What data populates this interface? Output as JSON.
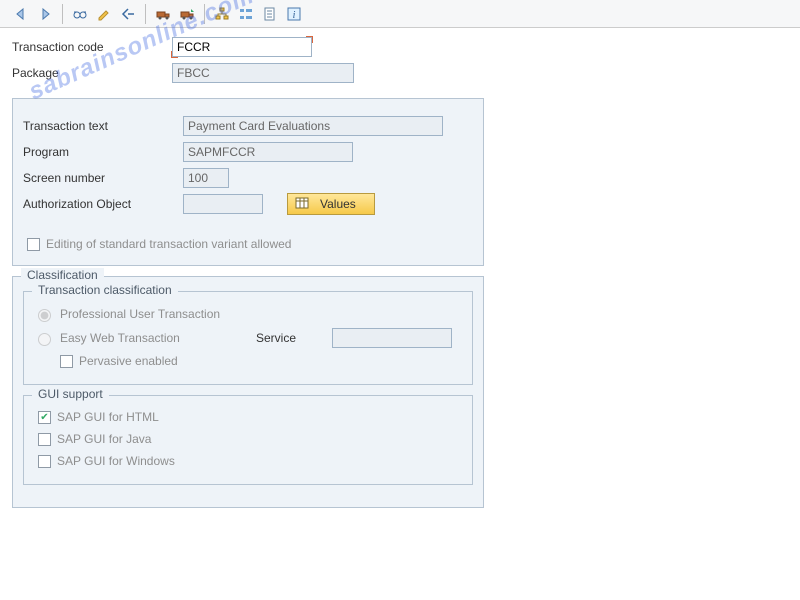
{
  "toolbar": {
    "back": "Back",
    "forward": "Forward",
    "glasses": "Display",
    "pencil": "Change",
    "copy": "Other object",
    "transport1": "Transport",
    "transport2": "Transport entry",
    "hierarchy": "Where-used",
    "align": "Object directory",
    "docu": "Documentation",
    "info": "Information"
  },
  "header": {
    "tcode_label": "Transaction code",
    "tcode_value": "FCCR",
    "package_label": "Package",
    "package_value": "FBCC"
  },
  "detail": {
    "text_label": "Transaction text",
    "text_value": "Payment Card Evaluations",
    "program_label": "Program",
    "program_value": "SAPMFCCR",
    "screen_label": "Screen number",
    "screen_value": "100",
    "auth_label": "Authorization Object",
    "auth_value": "",
    "values_label": "Values",
    "variant_checkbox": "Editing of standard transaction variant allowed"
  },
  "classification": {
    "title": "Classification",
    "tc_title": "Transaction classification",
    "opt_prof": "Professional User Transaction",
    "opt_easy": "Easy Web Transaction",
    "service_label": "Service",
    "service_value": "",
    "pervasive": "Pervasive enabled",
    "gui_title": "GUI support",
    "gui_html": "SAP GUI for HTML",
    "gui_java": "SAP GUI for Java",
    "gui_win": "SAP GUI for Windows"
  },
  "watermark": "sabrainsonline.com"
}
